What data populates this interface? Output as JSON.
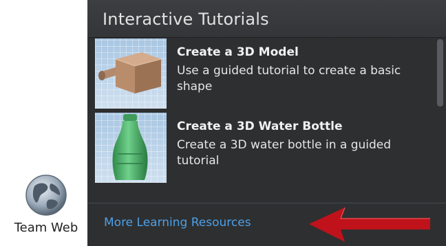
{
  "team_web": {
    "icon": "globe-icon",
    "label": "Team Web"
  },
  "panel": {
    "title": "Interactive Tutorials",
    "tutorials": [
      {
        "title": "Create a 3D Model",
        "description": "Use a guided tutorial to create a basic shape",
        "thumbnail": "3d-model-thumbnail"
      },
      {
        "title": "Create a 3D Water Bottle",
        "description": "Create a 3D water bottle in a guided tutorial",
        "thumbnail": "water-bottle-thumbnail"
      }
    ],
    "more_link": "More Learning Resources"
  },
  "colors": {
    "panel_bg": "#2e2f31",
    "link": "#4da0e6",
    "arrow": "#c0121a"
  }
}
